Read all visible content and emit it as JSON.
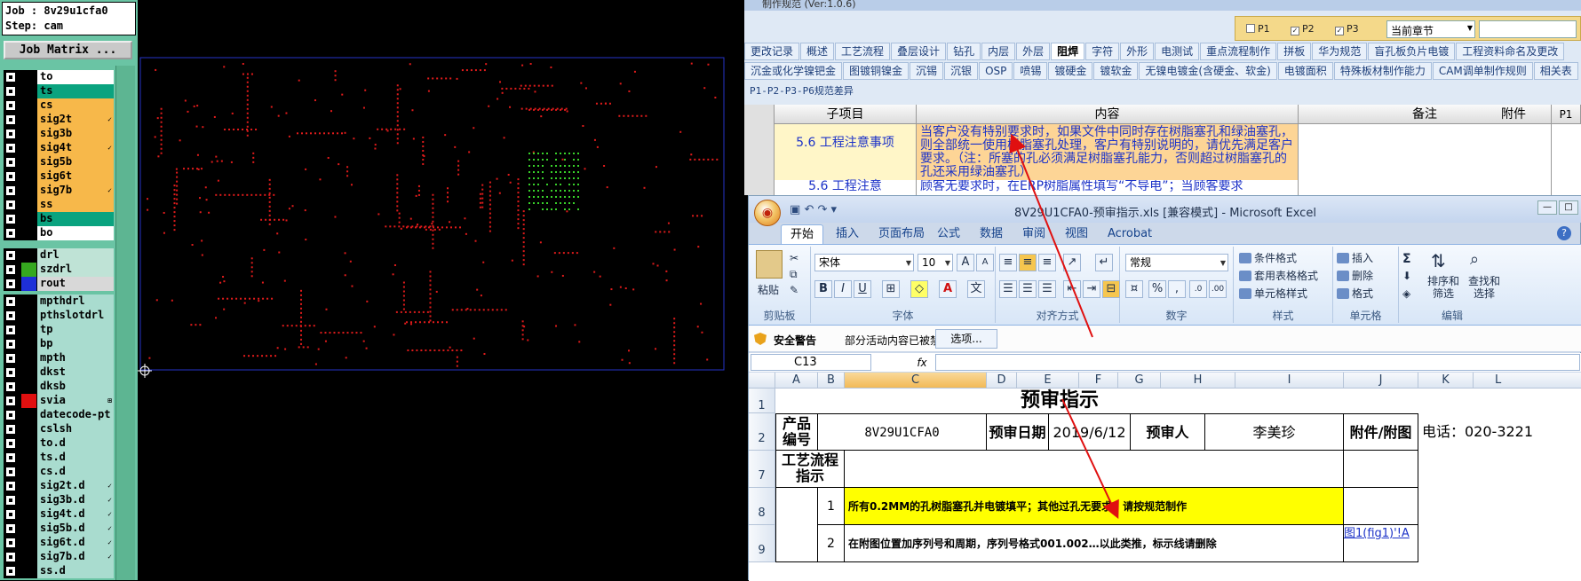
{
  "cam": {
    "job_line": "Job : 8v29u1cfa0",
    "step_line": "Step: cam",
    "job_matrix_label": "Job Matrix ...",
    "layers_board": [
      {
        "name": "to",
        "color": "#ffffff",
        "mark": ""
      },
      {
        "name": "ts",
        "color": "#0aa37f",
        "mark": ""
      },
      {
        "name": "cs",
        "color": "#f7b84a",
        "mark": ""
      },
      {
        "name": "sig2t",
        "color": "#f7b84a",
        "mark": "✓"
      },
      {
        "name": "sig3b",
        "color": "#f7b84a",
        "mark": ""
      },
      {
        "name": "sig4t",
        "color": "#f7b84a",
        "mark": "✓"
      },
      {
        "name": "sig5b",
        "color": "#f7b84a",
        "mark": ""
      },
      {
        "name": "sig6t",
        "color": "#f7b84a",
        "mark": ""
      },
      {
        "name": "sig7b",
        "color": "#f7b84a",
        "mark": "✓"
      },
      {
        "name": "ss",
        "color": "#f7b84a",
        "mark": ""
      },
      {
        "name": "bs",
        "color": "#0aa37f",
        "mark": ""
      },
      {
        "name": "bo",
        "color": "#ffffff",
        "mark": ""
      }
    ],
    "layers_drill": [
      {
        "name": "drl",
        "color": "#bfe3d6",
        "swatch": "#000000"
      },
      {
        "name": "szdrl",
        "color": "#bfe3d6",
        "swatch": "#35a81f"
      },
      {
        "name": "rout",
        "color": "#d8d8d8",
        "swatch": "#1e2fd8"
      }
    ],
    "layers_misc": [
      {
        "name": "mpthdrl",
        "swatch": "#000000",
        "mark": ""
      },
      {
        "name": "pthslotdrl",
        "swatch": "#000000",
        "mark": ""
      },
      {
        "name": "tp",
        "swatch": "#000000",
        "mark": ""
      },
      {
        "name": "bp",
        "swatch": "#000000",
        "mark": ""
      },
      {
        "name": "mpth",
        "swatch": "#000000",
        "mark": ""
      },
      {
        "name": "dkst",
        "swatch": "#000000",
        "mark": ""
      },
      {
        "name": "dksb",
        "swatch": "#000000",
        "mark": ""
      },
      {
        "name": "svia",
        "swatch": "#e01010",
        "mark": "⊞"
      },
      {
        "name": "datecode-pt",
        "swatch": "#000000",
        "mark": ""
      },
      {
        "name": "cslsh",
        "swatch": "#000000",
        "mark": ""
      },
      {
        "name": "to.d",
        "swatch": "#000000",
        "mark": ""
      },
      {
        "name": "ts.d",
        "swatch": "#000000",
        "mark": ""
      },
      {
        "name": "cs.d",
        "swatch": "#000000",
        "mark": ""
      },
      {
        "name": "sig2t.d",
        "swatch": "#000000",
        "mark": "✓"
      },
      {
        "name": "sig3b.d",
        "swatch": "#000000",
        "mark": "✓"
      },
      {
        "name": "sig4t.d",
        "swatch": "#000000",
        "mark": "✓"
      },
      {
        "name": "sig5b.d",
        "swatch": "#000000",
        "mark": "✓"
      },
      {
        "name": "sig6t.d",
        "swatch": "#000000",
        "mark": "✓"
      },
      {
        "name": "sig7b.d",
        "swatch": "#000000",
        "mark": "✓"
      },
      {
        "name": "ss.d",
        "swatch": "#000000",
        "mark": ""
      }
    ],
    "colors": {
      "drill_dot": "#e01b1b",
      "via_dot": "#38d02a",
      "profile": "#2634c9"
    }
  },
  "spec": {
    "window_title": "制作规范 (Ver:1.0.6)",
    "filters": [
      {
        "label": "P1",
        "checked": false
      },
      {
        "label": "P2",
        "checked": true
      },
      {
        "label": "P3",
        "checked": true
      }
    ],
    "select_value": "当前章节",
    "tabs_row1": [
      "更改记录",
      "概述",
      "工艺流程",
      "叠层设计",
      "钻孔",
      "内层",
      "外层",
      "阻焊",
      "字符",
      "外形",
      "电测试",
      "重点流程制作",
      "拼板",
      "华为规范",
      "盲孔板负片电镀",
      "工程资料命名及更改"
    ],
    "active_tab": "阻焊",
    "tabs_row2": [
      "沉金或化学镍钯金",
      "图镀铜镍金",
      "沉锡",
      "沉银",
      "OSP",
      "喷锡",
      "镀硬金",
      "镀软金",
      "无镍电镀金(含硬金、软金)",
      "电镀面积",
      "特殊板材制作能力",
      "CAM调单制作规则",
      "相关表"
    ],
    "sub_label": "P1-P2-P3-P6规范差异",
    "headers": {
      "sub": "子项目",
      "content": "内容",
      "note": "备注",
      "attach": "附件",
      "p": "P1"
    },
    "rows": [
      {
        "sub": "5.6 工程注意事项",
        "content": "当客户没有特别要求时，如果文件中同时存在树脂塞孔和绿油塞孔，则全部统一使用树脂塞孔处理，客户有特别说明的，请优先满足客户要求。（注：所塞的孔必须满足树脂塞孔能力，否则超过树脂塞孔的孔还采用绿油塞孔）"
      },
      {
        "sub": "5.6 工程注意",
        "content": "顾客无要求时，在ERP树脂属性填写“不导电”；当顾客要求"
      }
    ]
  },
  "excel": {
    "title": "8V29U1CFA0-预审指示.xls [兼容模式] - Microsoft Excel",
    "tabs": [
      "开始",
      "插入",
      "页面布局",
      "公式",
      "数据",
      "审阅",
      "视图",
      "Acrobat"
    ],
    "active_tab": "开始",
    "ribbon": {
      "paste": "粘贴",
      "clipboard": "剪贴板",
      "font_name": "宋体",
      "font_size": "10",
      "font_group": "字体",
      "align_group": "对齐方式",
      "number_format": "常规",
      "number_group": "数字",
      "cond_format": "条件格式",
      "table_format": "套用表格格式",
      "cell_style": "单元格样式",
      "style_group": "样式",
      "insert": "插入",
      "delete": "删除",
      "format": "格式",
      "cells_group": "单元格",
      "sort_filter": "排序和筛选",
      "find_select": "查找和选择",
      "edit_group": "编辑"
    },
    "security_title": "安全警告",
    "security_msg": "部分活动内容已被禁用。",
    "security_btn": "选项...",
    "namebox": "C13",
    "fx": "fx",
    "columns": [
      "A",
      "B",
      "C",
      "D",
      "E",
      "F",
      "G",
      "H",
      "I",
      "J",
      "K",
      "L"
    ],
    "rows_labels": [
      "1",
      "2",
      "7",
      "8",
      "9"
    ],
    "sheet": {
      "title": "预审指示",
      "product_label": "产品编号",
      "product_value": "8V29U1CFA0",
      "date_label": "预审日期",
      "date_value": "2019/6/12",
      "reviewer_label": "预审人",
      "reviewer_value": "李美珍",
      "attach_label": "附件/附图",
      "phone": "电话：020-3221",
      "process_label": "工艺流程指示",
      "items": [
        {
          "no": "1",
          "text": "所有0.2MM的孔树脂塞孔并电镀填平；其他过孔无要求，请按规范制作",
          "link": ""
        },
        {
          "no": "2",
          "text": "在附图位置加序列号和周期，序列号格式001.002…以此类推，标示线请删除",
          "link": "图1(fig1)'!A"
        }
      ]
    },
    "colors": {
      "highlight": "#ffff00",
      "selected_header": "#f2b957",
      "link": "#1d33c8",
      "arrow": "#e01010"
    }
  }
}
